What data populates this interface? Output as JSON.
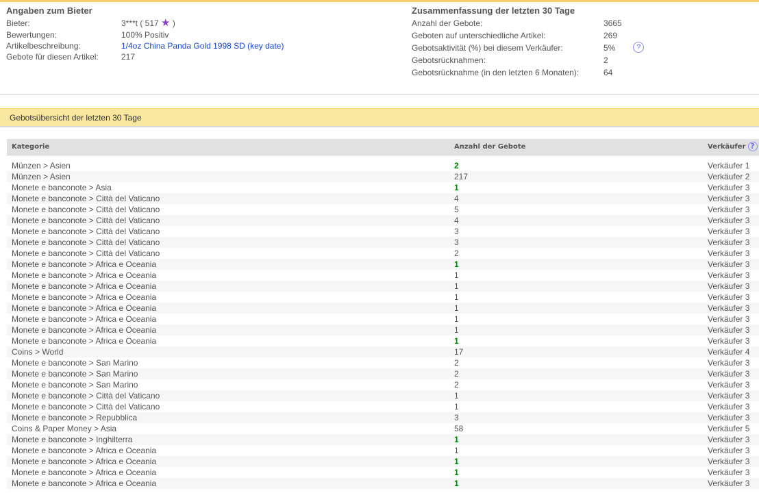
{
  "bidder": {
    "title": "Angaben zum Bieter",
    "bieter_label": "Bieter:",
    "bieter_value": "3***t ( 517",
    "bieter_close": ")",
    "star_icon": "purple-star-icon",
    "bewertungen_label": "Bewertungen:",
    "bewertungen_value": "100% Positiv",
    "artikel_label": "Artikelbeschreibung:",
    "artikel_value": "1/4oz China Panda Gold 1998 SD (key date)",
    "gebote_label": "Gebote für diesen Artikel:",
    "gebote_value": "217"
  },
  "summary": {
    "title": "Zusammenfassung der letzten 30 Tage",
    "items": [
      {
        "label": "Anzahl der Gebote:",
        "value": "3665"
      },
      {
        "label": "Geboten auf unterschiedliche Artikel:",
        "value": "269"
      },
      {
        "label": "Gebotsaktivität (%) bei diesem Verkäufer:",
        "value": "5%",
        "help": "?"
      },
      {
        "label": "Gebotsrücknahmen:",
        "value": "2"
      },
      {
        "label": "Gebotsrücknahme (in den letzten 6 Monaten):",
        "value": "64"
      }
    ]
  },
  "overview": {
    "title": "Gebotsübersicht der letzten 30 Tage",
    "headers": {
      "kategorie": "Kategorie",
      "anzahl": "Anzahl der Gebote",
      "verkaeufer": "Verkäufer",
      "help": "?"
    },
    "rows": [
      [
        "Münzen > Asien",
        "2",
        "Verkäufer 1",
        true
      ],
      [
        "Münzen > Asien",
        "217",
        "Verkäufer 2",
        false
      ],
      [
        "Monete e banconote > Asia",
        "1",
        "Verkäufer 3",
        true
      ],
      [
        "Monete e banconote > Città del Vaticano",
        "4",
        "Verkäufer 3",
        false
      ],
      [
        "Monete e banconote > Città del Vaticano",
        "5",
        "Verkäufer 3",
        false
      ],
      [
        "Monete e banconote > Città del Vaticano",
        "4",
        "Verkäufer 3",
        false
      ],
      [
        "Monete e banconote > Città del Vaticano",
        "3",
        "Verkäufer 3",
        false
      ],
      [
        "Monete e banconote > Città del Vaticano",
        "3",
        "Verkäufer 3",
        false
      ],
      [
        "Monete e banconote > Città del Vaticano",
        "2",
        "Verkäufer 3",
        false
      ],
      [
        "Monete e banconote > Africa e Oceania",
        "1",
        "Verkäufer 3",
        true
      ],
      [
        "Monete e banconote > Africa e Oceania",
        "1",
        "Verkäufer 3",
        false
      ],
      [
        "Monete e banconote > Africa e Oceania",
        "1",
        "Verkäufer 3",
        false
      ],
      [
        "Monete e banconote > Africa e Oceania",
        "1",
        "Verkäufer 3",
        false
      ],
      [
        "Monete e banconote > Africa e Oceania",
        "1",
        "Verkäufer 3",
        false
      ],
      [
        "Monete e banconote > Africa e Oceania",
        "1",
        "Verkäufer 3",
        false
      ],
      [
        "Monete e banconote > Africa e Oceania",
        "1",
        "Verkäufer 3",
        false
      ],
      [
        "Monete e banconote > Africa e Oceania",
        "1",
        "Verkäufer 3",
        true
      ],
      [
        "Coins > World",
        "17",
        "Verkäufer 4",
        false
      ],
      [
        "Monete e banconote > San Marino",
        "2",
        "Verkäufer 3",
        false
      ],
      [
        "Monete e banconote > San Marino",
        "2",
        "Verkäufer 3",
        false
      ],
      [
        "Monete e banconote > San Marino",
        "2",
        "Verkäufer 3",
        false
      ],
      [
        "Monete e banconote > Città del Vaticano",
        "1",
        "Verkäufer 3",
        false
      ],
      [
        "Monete e banconote > Città del Vaticano",
        "1",
        "Verkäufer 3",
        false
      ],
      [
        "Monete e banconote > Repubblica",
        "3",
        "Verkäufer 3",
        false
      ],
      [
        "Coins & Paper Money > Asia",
        "58",
        "Verkäufer 5",
        false
      ],
      [
        "Monete e banconote > Inghilterra",
        "1",
        "Verkäufer 3",
        true
      ],
      [
        "Monete e banconote > Africa e Oceania",
        "1",
        "Verkäufer 3",
        false
      ],
      [
        "Monete e banconote > Africa e Oceania",
        "1",
        "Verkäufer 3",
        true
      ],
      [
        "Monete e banconote > Africa e Oceania",
        "1",
        "Verkäufer 3",
        true
      ],
      [
        "Monete e banconote > Africa e Oceania",
        "1",
        "Verkäufer 3",
        true
      ]
    ]
  }
}
